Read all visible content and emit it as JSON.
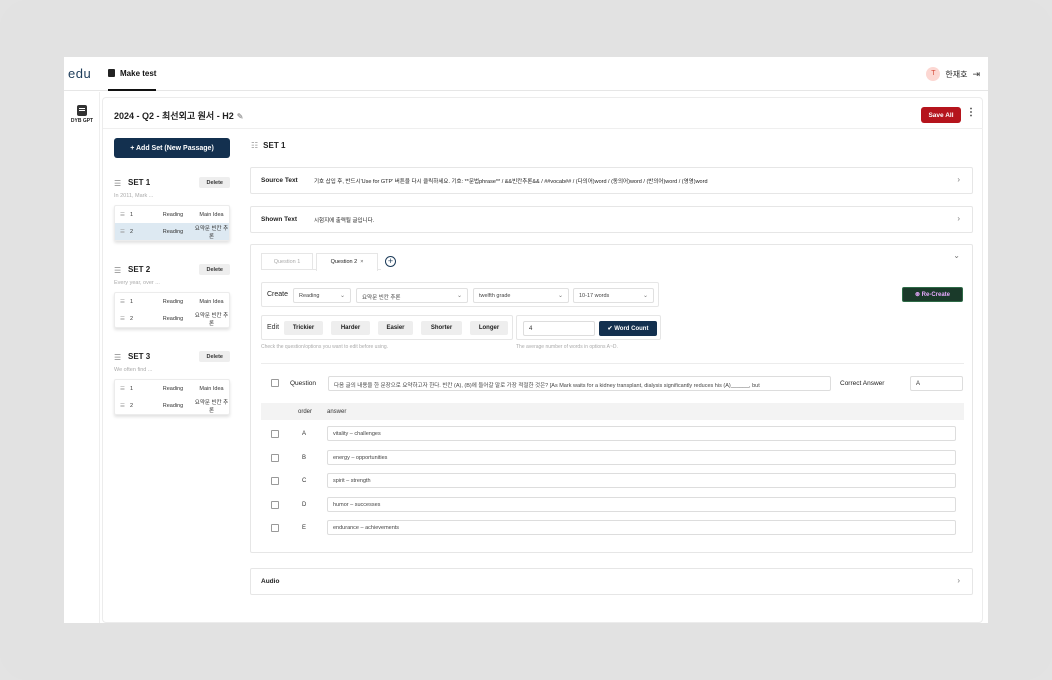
{
  "app": {
    "logo": "edu",
    "nav_tab": "Make test",
    "user_initial": "T",
    "user_name": "한재호",
    "logout_icon": "⇥"
  },
  "rail": {
    "label": "DYB GPT"
  },
  "header": {
    "title": "2024 - Q2 - 최선외고 원서 - H2",
    "edit_icon": "✎",
    "save_label": "Save All",
    "more": "⋮"
  },
  "sidebar": {
    "add_set_label": "Add Set (New Passage)",
    "delete_label": "Delete",
    "sets": [
      {
        "name": "SET 1",
        "preview": "In 2011, Mark ...",
        "rows": [
          {
            "num": "1",
            "kind": "Reading",
            "type": "Main Idea"
          },
          {
            "num": "2",
            "kind": "Reading",
            "type": "요약문 빈칸 추론"
          }
        ]
      },
      {
        "name": "SET 2",
        "preview": "Every year, over ...",
        "rows": [
          {
            "num": "1",
            "kind": "Reading",
            "type": "Main Idea"
          },
          {
            "num": "2",
            "kind": "Reading",
            "type": "요약문 빈칸 추론"
          }
        ]
      },
      {
        "name": "SET 3",
        "preview": "We often find ...",
        "rows": [
          {
            "num": "1",
            "kind": "Reading",
            "type": "Main Idea"
          },
          {
            "num": "2",
            "kind": "Reading",
            "type": "요약문 빈칸 추론"
          }
        ]
      }
    ]
  },
  "set_panel": {
    "title": "SET 1",
    "source_label": "Source Text",
    "source_value": "기호 삽입 후, 반드시'Use for GTP' 버튼을 다시 클릭하세요. 기호: **문법phrase** / &&빈칸추론&& / ##vocab## / (다의어)word / (동의어)word / (반의어)word / (영영)word",
    "shown_label": "Shown Text",
    "shown_value": "시험지에 출력될 글입니다.",
    "audio_label": "Audio",
    "chevron": "›"
  },
  "question": {
    "tabs": [
      "Question 1",
      "Question 2"
    ],
    "close": "×",
    "add": "+",
    "collapse": "⌄",
    "create_label": "Create",
    "create_selects": [
      "Reading",
      "요약문 빈칸 추론",
      "twelfth grade",
      "10-17 words"
    ],
    "recreate_label": "Re-Create",
    "edit_label": "Edit",
    "edit_buttons": [
      "Trickier",
      "Harder",
      "Easier",
      "Shorter",
      "Longer"
    ],
    "word_count_value": "4",
    "word_count_label": "Word Count",
    "hint_edit": "Check the question/options you want to edit before using.",
    "hint_wc": "The average number of words in options A~D.",
    "question_label": "Question",
    "question_text": "다음 글의 내용을 한 문장으로 요약하고자 한다. 빈칸 (A), (B)에 들어갈 말로 가장 적절한 것은? [As Mark waits for a kidney transplant, dialysis significantly reduces his (A)______, but",
    "correct_label": "Correct Answer",
    "correct_value": "A",
    "answer_head_order": "order",
    "answer_head_answer": "answer",
    "answers": [
      {
        "letter": "A",
        "text": "vitality – challenges"
      },
      {
        "letter": "B",
        "text": "energy – opportunities"
      },
      {
        "letter": "C",
        "text": "spirit – strength"
      },
      {
        "letter": "D",
        "text": "humor – successes"
      },
      {
        "letter": "E",
        "text": "endurance – achievements"
      }
    ]
  },
  "colors": {
    "primary_navy": "#13304f",
    "save_red": "#b5141c",
    "recreate_bg": "#1a3a2a",
    "recreate_text": "#e8a9ff"
  }
}
